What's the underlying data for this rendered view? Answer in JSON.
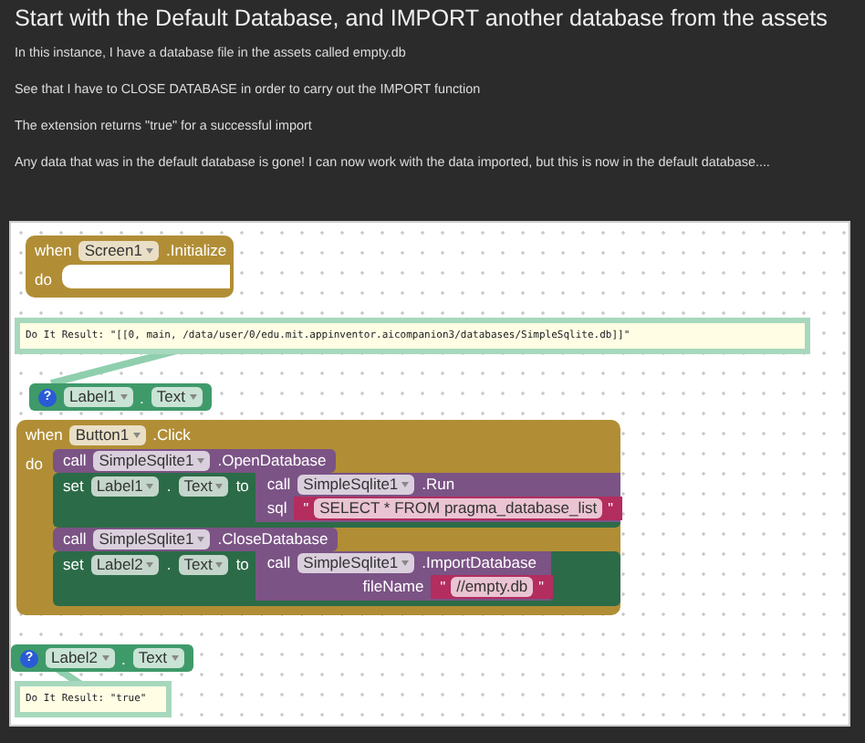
{
  "post": {
    "title": "Start with the Default Database, and IMPORT another database from the assets",
    "paragraphs": [
      "In this instance, I have a database file in the assets called empty.db",
      "See that I have to CLOSE DATABASE in order to carry out the IMPORT function",
      "The extension returns \"true\" for a successful import",
      "Any data that was in the default database is gone! I can now work with the data imported, but this is now in the default database...."
    ]
  },
  "workspace": {
    "blocks": [
      {
        "kind": "event",
        "when": "when",
        "component": "Screen1",
        "event": ".Initialize",
        "do": "do"
      },
      {
        "kind": "result",
        "text": "Do It Result: \"[[0, main, /data/user/0/edu.mit.appinventor.aicompanion3/databases/SimpleSqlite.db]]\""
      },
      {
        "kind": "getter",
        "badge": "?",
        "component": "Label1",
        "dot": ".",
        "property": "Text"
      },
      {
        "kind": "event",
        "when": "when",
        "component": "Button1",
        "event": ".Click",
        "do": "do",
        "statements": [
          {
            "kind": "call",
            "call": "call",
            "component": "SimpleSqlite1",
            "method": ".OpenDatabase"
          },
          {
            "kind": "set",
            "set": "set",
            "component": "Label1",
            "dot": ".",
            "property": "Text",
            "to": "to",
            "value": {
              "call": "call",
              "component": "SimpleSqlite1",
              "method": ".Run",
              "arg_name": "sql",
              "left_quote": "\"",
              "text": "SELECT * FROM pragma_database_list",
              "right_quote": "\""
            }
          },
          {
            "kind": "call",
            "call": "call",
            "component": "SimpleSqlite1",
            "method": ".CloseDatabase"
          },
          {
            "kind": "set",
            "set": "set",
            "component": "Label2",
            "dot": ".",
            "property": "Text",
            "to": "to",
            "value": {
              "call": "call",
              "component": "SimpleSqlite1",
              "method": ".ImportDatabase",
              "arg_name": "fileName",
              "left_quote": "\"",
              "text": "//empty.db",
              "right_quote": "\""
            }
          }
        ]
      },
      {
        "kind": "getter",
        "badge": "?",
        "component": "Label2",
        "dot": ".",
        "property": "Text"
      },
      {
        "kind": "result",
        "text": "Do It Result: \"true\""
      }
    ]
  }
}
